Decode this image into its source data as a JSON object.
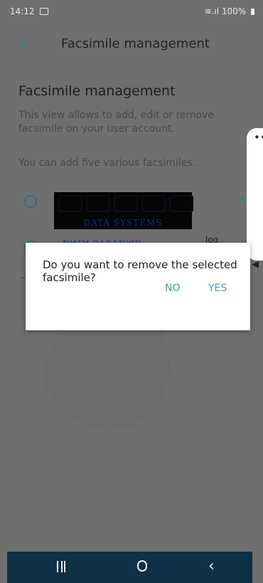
{
  "status_bar": {
    "time": "14:12",
    "signal_battery": "≋.ıl 100%"
  },
  "header": {
    "title": "Facsimile management"
  },
  "page": {
    "heading": "Facsimile management",
    "description": "This view allows to add, edit or remove facsimile on your user account.",
    "hint": "You can add five various facsimiles."
  },
  "facsimile_image": {
    "caption": "DATA SYSTEMS"
  },
  "background_texts": {
    "flipped": "DATA SYSTEMS",
    "log": "log"
  },
  "side_panel": {
    "dots": "••",
    "speaker": "◀"
  },
  "dialog": {
    "message": "Do you want to remove the selected facsimile?",
    "no_label": "NO",
    "yes_label": "YES"
  },
  "icons": {
    "back": "arrow-left-icon",
    "remove": "close-icon",
    "radio": "radio-button-icon",
    "gallery": "gallery-icon",
    "battery": "battery-icon"
  },
  "colors": {
    "accent": "#3a9bb0",
    "nav_bar": "#0f3145",
    "scrim": "#6f6f6f"
  }
}
